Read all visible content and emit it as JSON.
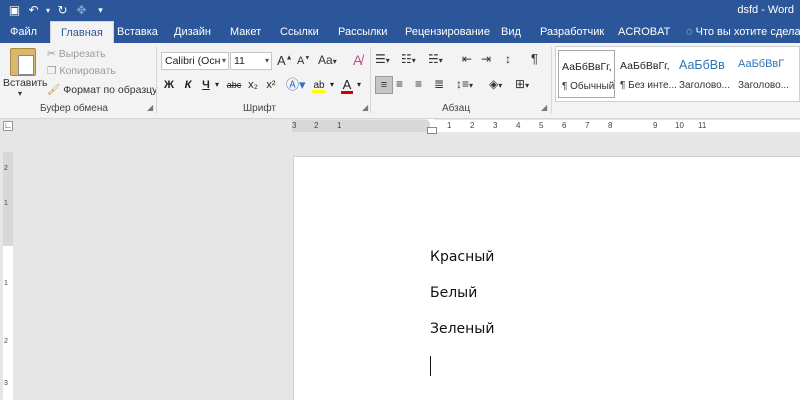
{
  "titlebar": {
    "save_icon": "save-icon",
    "undo_icon": "undo-icon",
    "redo_icon": "redo-icon",
    "touch_icon": "touch-mode-icon",
    "customize_icon": "customize-qat-icon",
    "title": "dsfd - Word"
  },
  "tabs": [
    {
      "label": "Файл"
    },
    {
      "label": "Главная"
    },
    {
      "label": "Вставка"
    },
    {
      "label": "Дизайн"
    },
    {
      "label": "Макет"
    },
    {
      "label": "Ссылки"
    },
    {
      "label": "Рассылки"
    },
    {
      "label": "Рецензирование"
    },
    {
      "label": "Вид"
    },
    {
      "label": "Разработчик"
    },
    {
      "label": "ACROBAT"
    }
  ],
  "tellme": {
    "label": "Что вы хотите сделать?"
  },
  "clipboard": {
    "paste_label": "Вставить",
    "cut_label": "Вырезать",
    "copy_label": "Копировать",
    "format_painter_label": "Формат по образцу",
    "group_label": "Буфер обмена"
  },
  "font": {
    "font_name": "Calibri (Осн",
    "font_size": "11",
    "change_case": "Aa",
    "bold": "Ж",
    "italic": "К",
    "underline": "Ч",
    "strikethrough": "abc",
    "subscript": "x₂",
    "superscript": "x²",
    "group_label": "Шрифт",
    "highlight_color": "#ffff00",
    "font_color": "#d00000"
  },
  "paragraph": {
    "group_label": "Абзац"
  },
  "styles": [
    {
      "sample": "АаБбВвГг,",
      "name": "¶ Обычный"
    },
    {
      "sample": "АаБбВвГг,",
      "name": "¶ Без инте..."
    },
    {
      "sample": "АаБбВв",
      "name": "Заголово..."
    },
    {
      "sample": "АаБбВвГ",
      "name": "Заголово..."
    }
  ],
  "ruler": {
    "ticks": [
      "3",
      "2",
      "1",
      "1",
      "2",
      "3",
      "4",
      "5",
      "6",
      "7",
      "8",
      "9",
      "10",
      "11"
    ]
  },
  "vruler": {
    "ticks": [
      "2",
      "1",
      "1",
      "2",
      "3"
    ]
  },
  "document": {
    "lines": [
      "Красный",
      "Белый",
      "Зеленый"
    ]
  }
}
